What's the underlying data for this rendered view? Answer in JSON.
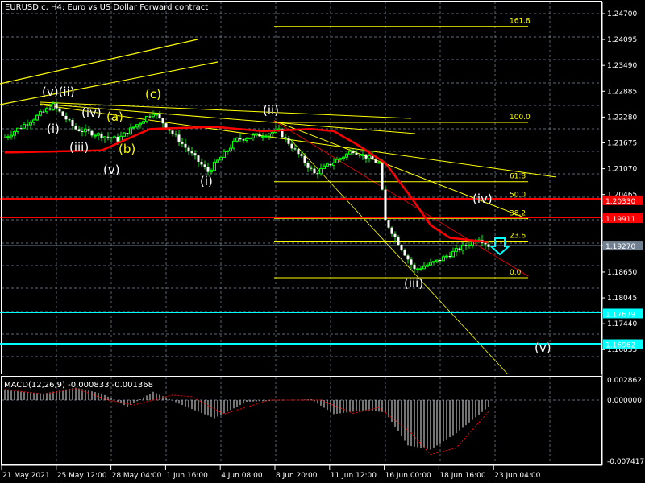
{
  "header": {
    "title": "EURUSD.c, H4:  Euro vs US Dollar Forward contract"
  },
  "price_axis": {
    "ticks": [
      "1.24700",
      "1.24095",
      "1.23490",
      "1.22885",
      "1.22280",
      "1.21675",
      "1.21070",
      "1.20465",
      "1.19860",
      "1.19270",
      "1.18650",
      "1.18045",
      "1.17440",
      "1.16835"
    ],
    "current_price": "1.19270",
    "red_levels": [
      "1.20330",
      "1.19911"
    ],
    "cyan_levels": [
      "1.17679",
      "1.16962"
    ]
  },
  "time_axis": {
    "ticks": [
      "21 May 2021",
      "25 May 12:00",
      "28 May 04:00",
      "1 Jun 16:00",
      "4 Jun 08:00",
      "8 Jun 20:00",
      "11 Jun 12:00",
      "16 Jun 00:00",
      "18 Jun 16:00",
      "23 Jun 04:00"
    ]
  },
  "fibonacci": {
    "levels": [
      "161.8",
      "100.0",
      "61.8",
      "50.0",
      "38.2",
      "23.6",
      "0.0"
    ]
  },
  "waves": {
    "v_ii": "(v)(ii)",
    "i": "(i)",
    "iii": "(iii)",
    "iv": "(iv)",
    "v": "(v)",
    "a": "(a)",
    "b": "(b)",
    "c": "(c)",
    "ii2": "(ii)",
    "i2": "(i)",
    "iii2": "(iii)",
    "iv2": "(iv)",
    "v2": "(v)"
  },
  "macd": {
    "label": "MACD(12,26,9) -0.000833 -0.001368",
    "ticks": [
      "0.002862",
      "0.000000",
      "-0.007417"
    ]
  },
  "colors": {
    "bull": "#00ff00",
    "ma": "#ff0000",
    "fib": "#ffff00",
    "cyan": "#00ffff",
    "grid": "#8090a0"
  },
  "chart_data": {
    "type": "candlestick",
    "symbol": "EURUSD.c",
    "timeframe": "H4",
    "price_keypoints": [
      [
        0,
        1.218
      ],
      [
        15,
        1.2255
      ],
      [
        22,
        1.22
      ],
      [
        35,
        1.2175
      ],
      [
        46,
        1.224
      ],
      [
        58,
        1.214
      ],
      [
        63,
        1.21
      ],
      [
        72,
        1.2175
      ],
      [
        85,
        1.2195
      ],
      [
        96,
        1.2095
      ],
      [
        108,
        1.215
      ],
      [
        116,
        1.212
      ],
      [
        118,
        1.1985
      ],
      [
        127,
        1.187
      ],
      [
        134,
        1.189
      ],
      [
        140,
        1.1915
      ],
      [
        147,
        1.1945
      ],
      [
        150,
        1.1927
      ]
    ],
    "ma_keypoints": [
      [
        0,
        1.2145
      ],
      [
        30,
        1.215
      ],
      [
        45,
        1.22
      ],
      [
        65,
        1.2205
      ],
      [
        80,
        1.2195
      ],
      [
        95,
        1.22
      ],
      [
        102,
        1.2195
      ],
      [
        110,
        1.216
      ],
      [
        118,
        1.212
      ],
      [
        125,
        1.205
      ],
      [
        132,
        1.1975
      ],
      [
        138,
        1.1945
      ],
      [
        150,
        1.1935
      ]
    ],
    "macd_hist_keypoints": [
      [
        0,
        0.0012
      ],
      [
        12,
        0.0008
      ],
      [
        22,
        0.0015
      ],
      [
        30,
        0.0008
      ],
      [
        38,
        -0.0008
      ],
      [
        46,
        0.001
      ],
      [
        55,
        -0.0006
      ],
      [
        65,
        -0.0022
      ],
      [
        75,
        -0.0002
      ],
      [
        95,
        0.0001
      ],
      [
        102,
        -0.0017
      ],
      [
        112,
        -0.0012
      ],
      [
        118,
        -0.0015
      ],
      [
        125,
        -0.0055
      ],
      [
        132,
        -0.006
      ],
      [
        140,
        -0.004
      ],
      [
        150,
        -0.0008
      ]
    ],
    "macd_signal_keypoints": [
      [
        0,
        0.0013
      ],
      [
        12,
        0.0007
      ],
      [
        22,
        0.0014
      ],
      [
        32,
        0.0
      ],
      [
        40,
        -0.0006
      ],
      [
        52,
        0.0006
      ],
      [
        58,
        0.0004
      ],
      [
        68,
        -0.0017
      ],
      [
        82,
        0.0
      ],
      [
        98,
        0.0
      ],
      [
        108,
        -0.0016
      ],
      [
        116,
        -0.0009
      ],
      [
        126,
        -0.004
      ],
      [
        132,
        -0.0066
      ],
      [
        140,
        -0.0058
      ],
      [
        150,
        -0.0014
      ]
    ]
  }
}
